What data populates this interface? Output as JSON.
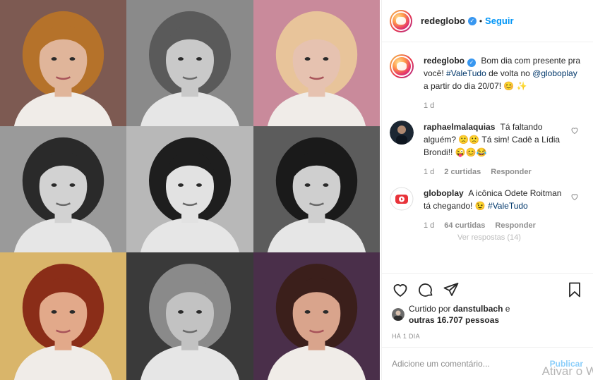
{
  "post": {
    "photos": [
      {
        "name": "photo-woman-red-hair",
        "bg": "#7d5a52",
        "skin": "#e0b59a",
        "hair": "#b5722a",
        "mono": false
      },
      {
        "name": "photo-man-gray-hair",
        "bg": "#8a8a8a",
        "skin": "#c9c9c9",
        "hair": "#5a5a5a",
        "mono": true
      },
      {
        "name": "photo-woman-blonde",
        "bg": "#c98a9b",
        "skin": "#e6c2b0",
        "hair": "#e8c49a",
        "mono": false
      },
      {
        "name": "photo-young-man",
        "bg": "#9a9a9a",
        "skin": "#d2d2d2",
        "hair": "#2a2a2a",
        "mono": true
      },
      {
        "name": "photo-woman-bangs",
        "bg": "#b8b8b8",
        "skin": "#e2e2e2",
        "hair": "#1e1e1e",
        "mono": true
      },
      {
        "name": "photo-woman-smiling",
        "bg": "#5c5c5c",
        "skin": "#cfcfcf",
        "hair": "#1a1a1a",
        "mono": true
      },
      {
        "name": "photo-woman-curly-red",
        "bg": "#d9b56a",
        "skin": "#e2a98a",
        "hair": "#8a2d18",
        "mono": false
      },
      {
        "name": "photo-man-glasses",
        "bg": "#3a3a3a",
        "skin": "#c2c2c2",
        "hair": "#8a8a8a",
        "mono": true
      },
      {
        "name": "photo-woman-short-hair",
        "bg": "#4a2f4a",
        "skin": "#d9a48c",
        "hair": "#3b1f1b",
        "mono": false
      }
    ]
  },
  "header": {
    "username": "redeglobo",
    "separator": "•",
    "follow_label": "Seguir"
  },
  "caption": {
    "username": "redeglobo",
    "text_1": "Bom dia com presente pra você!",
    "hashtag": "#ValeTudo",
    "text_2": "de volta no",
    "mention": "@globoplay",
    "text_3": "a partir do dia 20/07! 😊 ✨",
    "time": "1 d"
  },
  "comments": [
    {
      "username": "raphaelmalaquias",
      "text": "Tá faltando alguém? 🙁🙁 Tá sim! Cadê a Lídia Brondi!! 😜😊😂",
      "time": "1 d",
      "likes": "2 curtidas",
      "reply_label": "Responder"
    },
    {
      "username": "globoplay",
      "text": "A icônica Odete Roitman tá chegando! 😉",
      "hashtag": "#ValeTudo",
      "time": "1 d",
      "likes": "64 curtidas",
      "reply_label": "Responder",
      "view_replies": "Ver respostas (14)"
    }
  ],
  "actions": {
    "liked_by_prefix": "Curtido por",
    "liked_by_user": "danstulbach",
    "liked_by_and": "e",
    "liked_by_others": "outras 16.707 pessoas",
    "date": "HÁ 1 DIA"
  },
  "composer": {
    "placeholder": "Adicione um comentário...",
    "publish_label": "Publicar"
  },
  "watermark": "Ativar o W",
  "colors": {
    "link": "#00376b",
    "accent": "#0095f6",
    "verified": "#3897f0",
    "muted": "#8e8e8e"
  }
}
